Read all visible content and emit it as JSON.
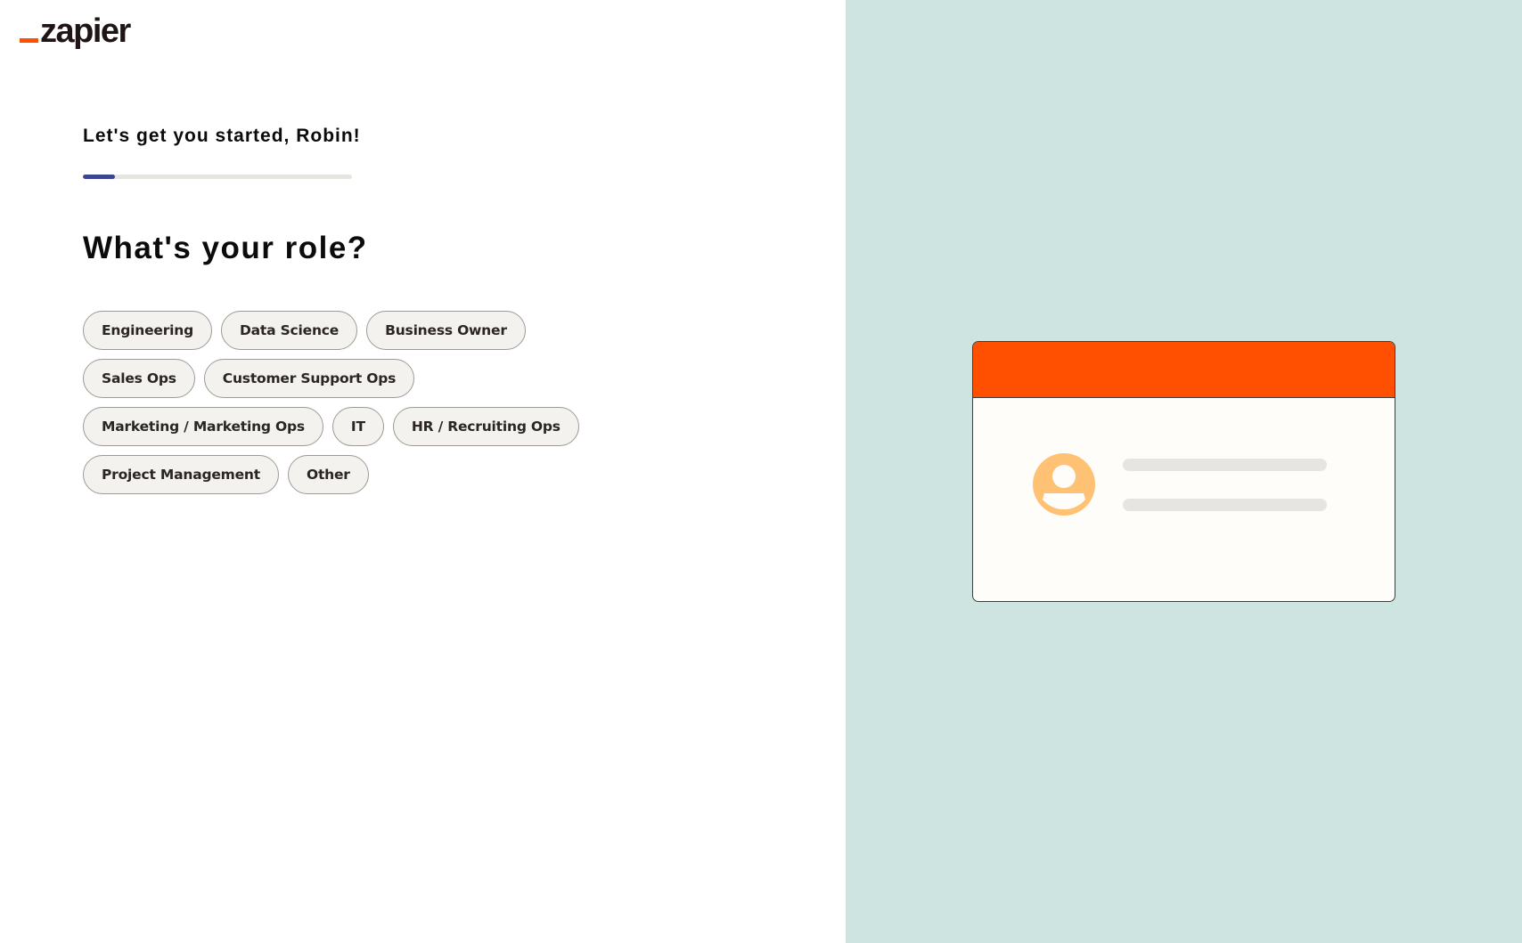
{
  "brand": {
    "name": "zapier",
    "accent_color": "#ff4f00"
  },
  "onboarding": {
    "greeting": "Let's get you started, Robin!",
    "progress_percent": 12,
    "progress_color": "#3d4592",
    "question": "What's your role?",
    "roles": [
      "Engineering",
      "Data Science",
      "Business Owner",
      "Sales Ops",
      "Customer Support Ops",
      "Marketing / Marketing Ops",
      "IT",
      "HR / Recruiting Ops",
      "Project Management",
      "Other"
    ]
  },
  "illustration": {
    "background_color": "#cee4e1",
    "card_header_color": "#ff4f00",
    "avatar_color": "#ffc173",
    "icon": "user-profile-card-icon"
  }
}
